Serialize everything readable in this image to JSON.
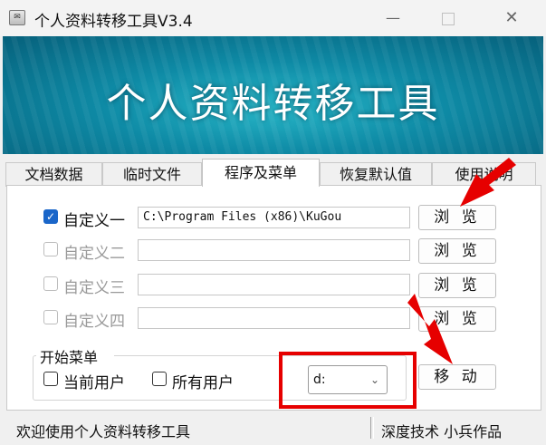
{
  "window": {
    "title": "个人资料转移工具V3.4",
    "app_icon": "app-icon",
    "min_label": "—",
    "close_label": "✕"
  },
  "banner": {
    "text": "个人资料转移工具"
  },
  "tabs": [
    {
      "label": "文档数据",
      "active": false
    },
    {
      "label": "临时文件",
      "active": false
    },
    {
      "label": "程序及菜单",
      "active": true
    },
    {
      "label": "恢复默认值",
      "active": false
    },
    {
      "label": "使用说明",
      "active": false
    }
  ],
  "rows": [
    {
      "label": "自定义一",
      "checked": true,
      "enabled": true,
      "path": "C:\\Program Files (x86)\\KuGou",
      "browse_label": "浏 览"
    },
    {
      "label": "自定义二",
      "checked": false,
      "enabled": false,
      "path": "",
      "browse_label": "浏 览"
    },
    {
      "label": "自定义三",
      "checked": false,
      "enabled": false,
      "path": "",
      "browse_label": "浏 览"
    },
    {
      "label": "自定义四",
      "checked": false,
      "enabled": false,
      "path": "",
      "browse_label": "浏 览"
    }
  ],
  "start_menu": {
    "group_title": "开始菜单",
    "current_user_label": "当前用户",
    "all_users_label": "所有用户",
    "drive_value": "d:",
    "move_label": "移 动"
  },
  "statusbar": {
    "left": "欢迎使用个人资料转移工具",
    "right": "深度技术 小兵作品"
  },
  "colors": {
    "annotation_red": "#e60000",
    "check_blue": "#1a66c9"
  }
}
